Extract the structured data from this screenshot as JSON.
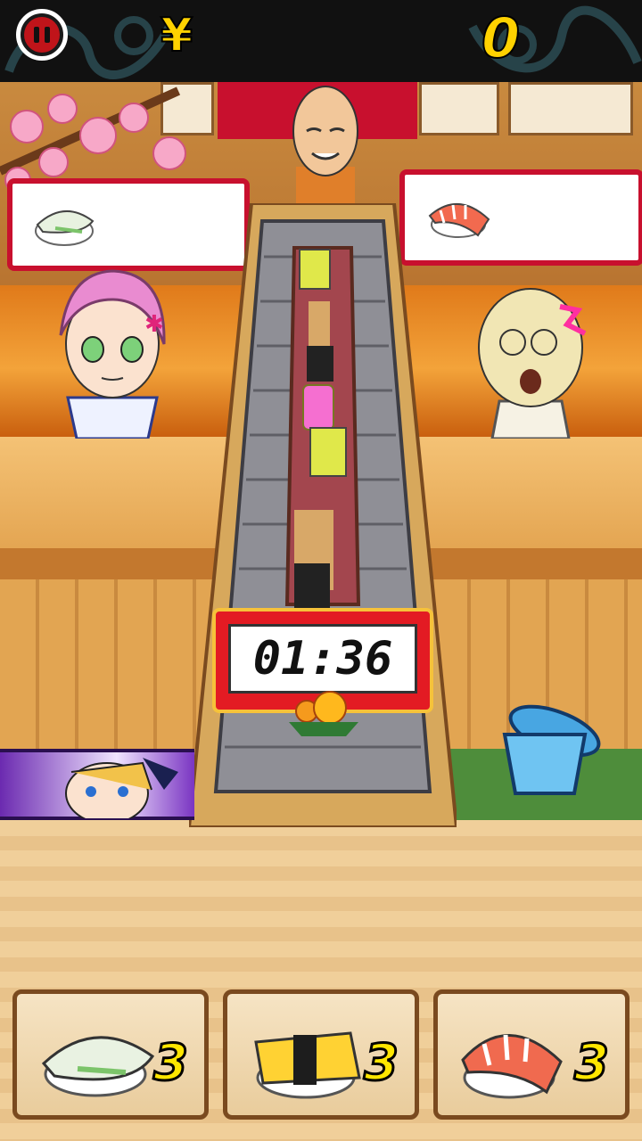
{
  "hud": {
    "currency_symbol": "¥",
    "score": "0"
  },
  "timer": {
    "value": "01:36"
  },
  "orders": {
    "left_customer_wants": "squid-nigiri-icon",
    "right_customer_wants": "shrimp-nigiri-icon"
  },
  "buttons": [
    {
      "item": "squid-nigiri-icon",
      "count": "3"
    },
    {
      "item": "tamago-nigiri-icon",
      "count": "3"
    },
    {
      "item": "shrimp-nigiri-icon",
      "count": "3"
    }
  ],
  "colors": {
    "accent_red": "#c8102e",
    "score_yellow": "#ffd200",
    "top_bar": "#111111"
  }
}
